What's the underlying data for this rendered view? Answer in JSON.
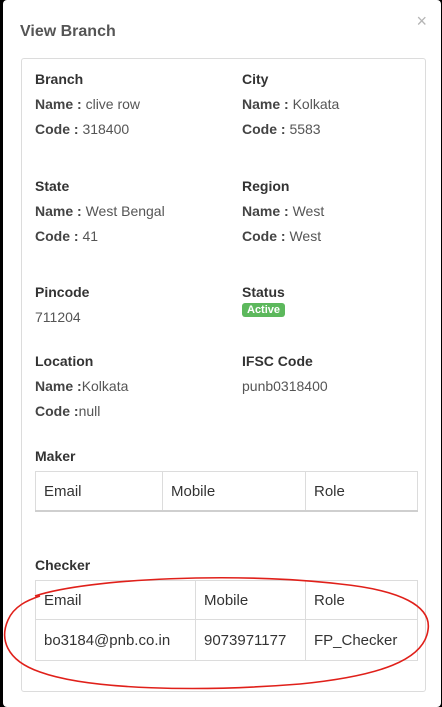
{
  "modal": {
    "title": "View Branch",
    "close_label": "×"
  },
  "branch": {
    "heading": "Branch",
    "name_label": "Name :",
    "name_value": "clive row",
    "code_label": "Code :",
    "code_value": "318400"
  },
  "city": {
    "heading": "City",
    "name_label": "Name :",
    "name_value": "Kolkata",
    "code_label": "Code :",
    "code_value": "5583"
  },
  "state": {
    "heading": "State",
    "name_label": "Name :",
    "name_value": "West Bengal",
    "code_label": "Code :",
    "code_value": "41"
  },
  "region": {
    "heading": "Region",
    "name_label": "Name :",
    "name_value": "West",
    "code_label": "Code :",
    "code_value": "West"
  },
  "pincode": {
    "heading": "Pincode",
    "value": "711204"
  },
  "status": {
    "heading": "Status",
    "badge": "Active",
    "badge_color": "#5cb85c"
  },
  "location": {
    "heading": "Location",
    "name_label": "Name :",
    "name_value": "Kolkata",
    "code_label": "Code :",
    "code_value": "null"
  },
  "ifsc": {
    "heading": "IFSC Code",
    "value": "punb0318400"
  },
  "maker": {
    "heading": "Maker",
    "columns": [
      "Email",
      "Mobile",
      "Role"
    ]
  },
  "checker": {
    "heading": "Checker",
    "columns": [
      "Email",
      "Mobile",
      "Role"
    ],
    "rows": [
      [
        "bo3184@pnb.co.in",
        "9073971177",
        "FP_Checker"
      ]
    ]
  },
  "annotation_color": "#e0201a"
}
